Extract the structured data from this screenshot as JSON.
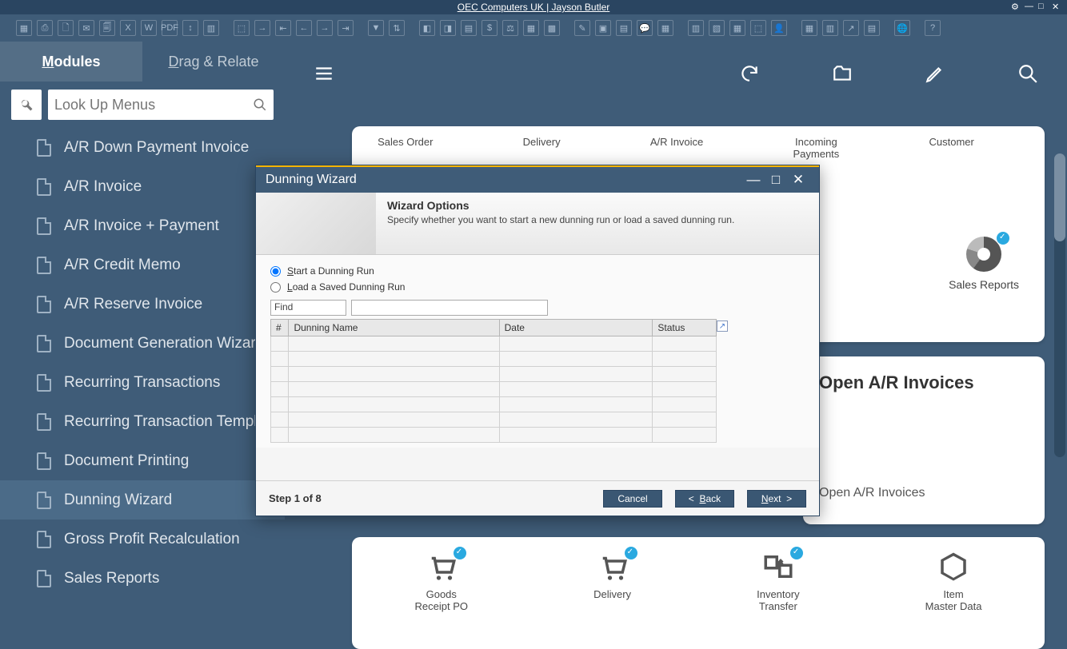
{
  "titlebar": {
    "company": "OEC Computers UK | Jayson Butler"
  },
  "side_tabs": {
    "modules": "Modules",
    "drag": "Drag & Relate"
  },
  "search": {
    "placeholder": "Look Up Menus"
  },
  "menu": [
    "A/R Down Payment Invoice",
    "A/R Invoice",
    "A/R Invoice + Payment",
    "A/R Credit Memo",
    "A/R Reserve Invoice",
    "Document Generation Wizard",
    "Recurring Transactions",
    "Recurring Transaction Templates",
    "Document Printing",
    "Dunning Wizard",
    "Gross Profit Recalculation",
    "Sales Reports"
  ],
  "tiles_top": {
    "sales_order": "Sales Order",
    "delivery": "Delivery",
    "ar_invoice": "A/R Invoice",
    "incoming_payments": "Incoming\nPayments",
    "customer": "Customer"
  },
  "sales_reports_label": "Sales Reports",
  "card_open_title": "Open A/R Invoices",
  "card_open_sub": "Open A/R Invoices",
  "tiles_bottom": {
    "goods_receipt": "Goods\nReceipt PO",
    "delivery": "Delivery",
    "inventory_transfer": "Inventory\nTransfer",
    "item_master": "Item\nMaster Data"
  },
  "dialog": {
    "title": "Dunning Wizard",
    "header_title": "Wizard Options",
    "header_desc": "Specify whether you want to start a new dunning run or load a saved dunning run.",
    "radio_start": "Start a Dunning Run",
    "radio_load": "Load a Saved Dunning Run",
    "find_label": "Find",
    "table": {
      "col_num": "#",
      "col_name": "Dunning Name",
      "col_date": "Date",
      "col_status": "Status"
    },
    "step": "Step 1 of 8",
    "btn_cancel": "Cancel",
    "btn_back_prefix": "<  ",
    "btn_back": "Back",
    "btn_next": "Next",
    "btn_next_suffix": "  >"
  }
}
